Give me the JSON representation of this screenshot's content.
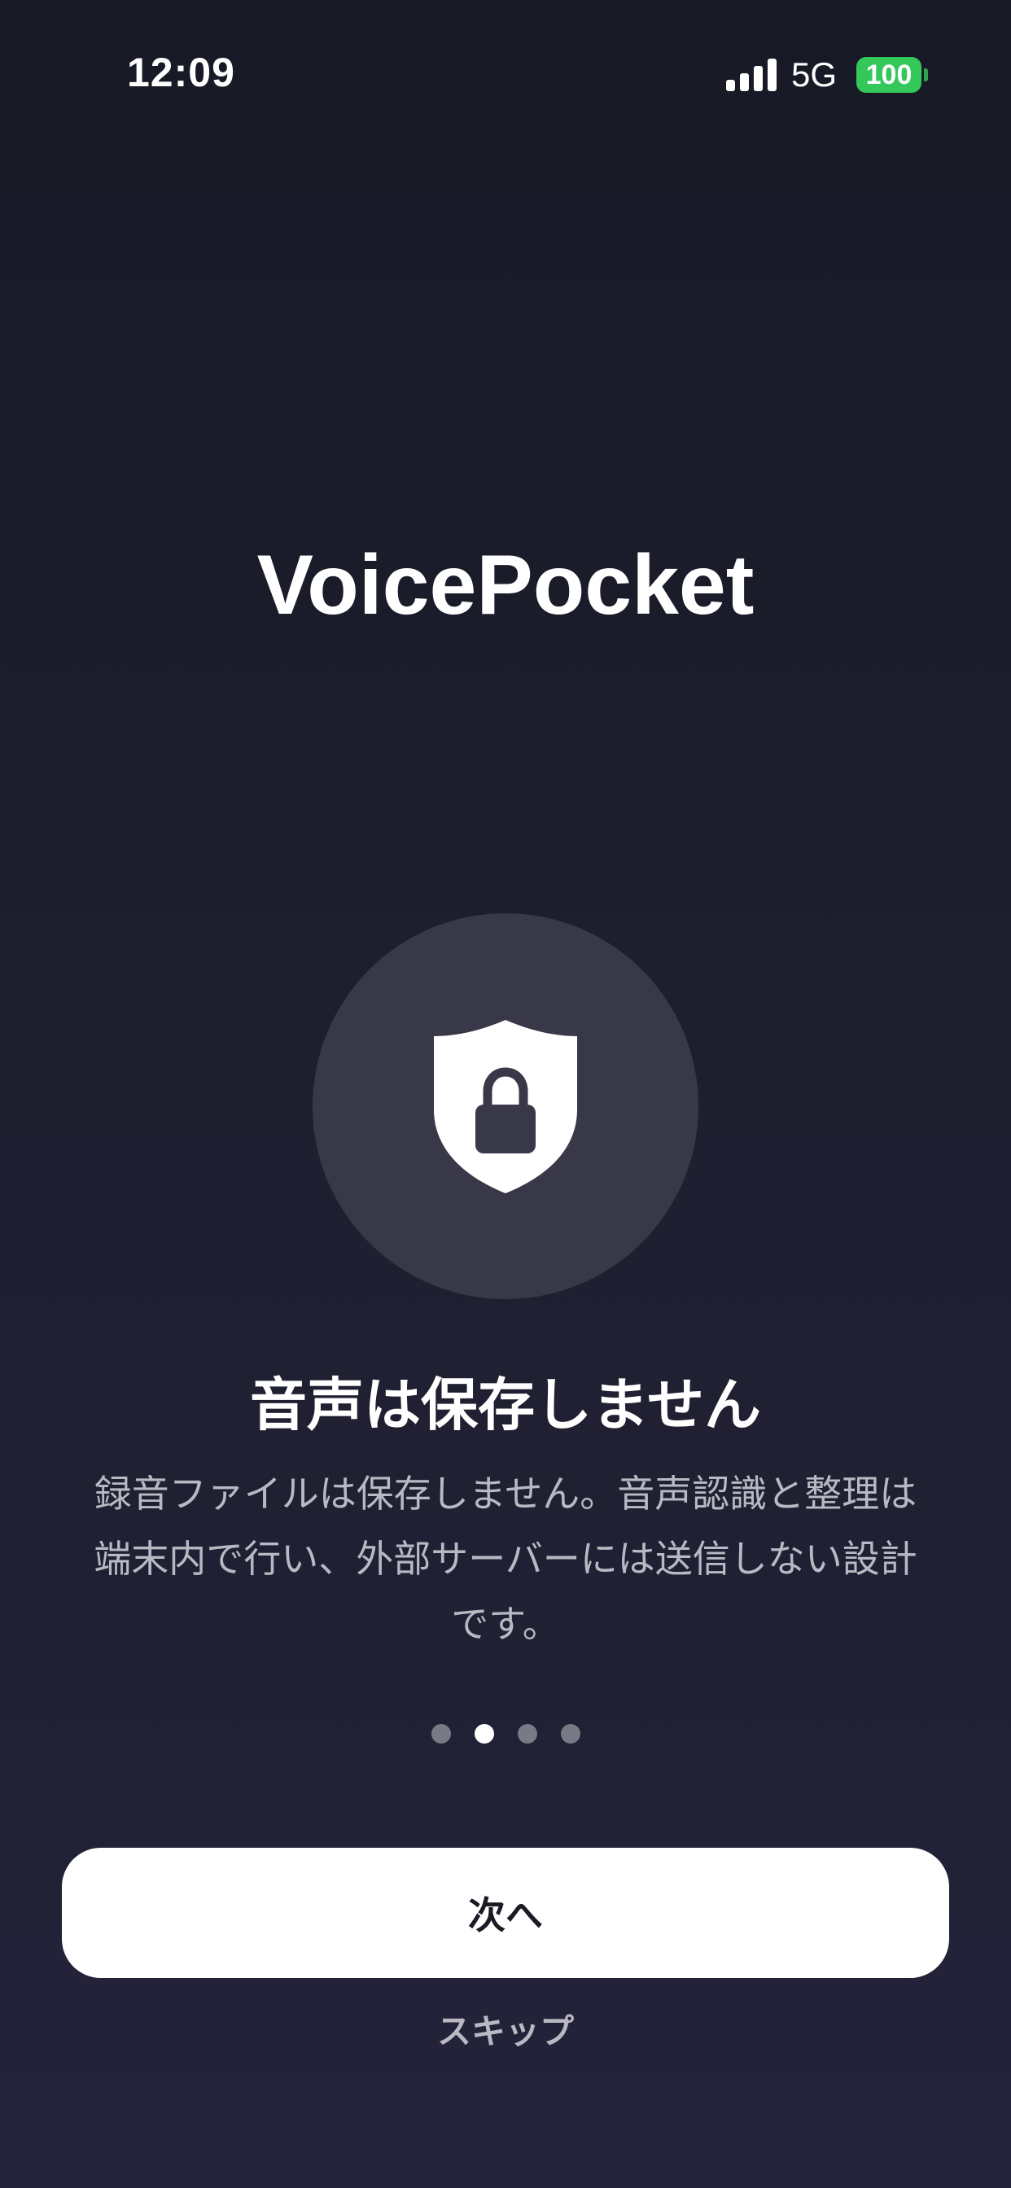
{
  "status_bar": {
    "time": "12:09",
    "network": "5G",
    "battery": "100",
    "battery_color": "#34c759",
    "signal_icon": "cellular-signal-icon"
  },
  "app": {
    "title": "VoicePocket"
  },
  "feature": {
    "icon": "shield-lock-icon",
    "heading": "音声は保存しません",
    "body_lines": [
      "録音ファイルは保存しません。音声認識と整理は",
      "端末内で行い、外部サーバーには送信しない設計",
      "です。"
    ]
  },
  "pager": {
    "total": 4,
    "active_index": 1
  },
  "actions": {
    "next_label": "次へ",
    "skip_label": "スキップ"
  }
}
